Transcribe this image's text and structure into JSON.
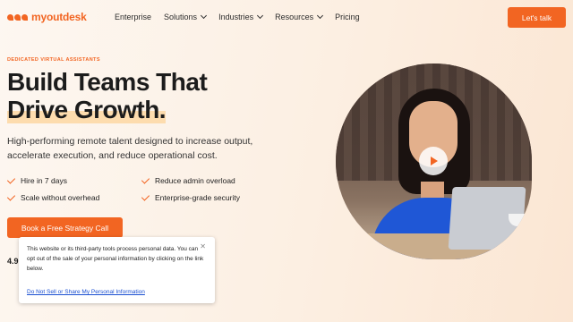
{
  "brand": {
    "name": "myoutdesk",
    "color": "#f26522"
  },
  "nav": {
    "items": [
      {
        "label": "Enterprise",
        "dropdown": false
      },
      {
        "label": "Solutions",
        "dropdown": true
      },
      {
        "label": "Industries",
        "dropdown": true
      },
      {
        "label": "Resources",
        "dropdown": true
      },
      {
        "label": "Pricing",
        "dropdown": false
      }
    ],
    "cta_label": "Let's talk"
  },
  "hero": {
    "eyebrow": "DEDICATED VIRTUAL ASSISTANTS",
    "title_line1": "Build Teams That",
    "title_line2": "Drive Growth.",
    "subtitle": "High-performing remote talent designed to increase output, accelerate execution, and reduce operational cost.",
    "features": [
      "Hire in 7 days",
      "Reduce admin overload",
      "Scale without overhead",
      "Enterprise-grade security"
    ],
    "cta_label": "Book a Free Strategy Call",
    "rating": "4.9"
  },
  "consent": {
    "text": "This website or its third-party tools process personal data. You can opt out of the sale of your personal information by clicking on the link below.",
    "link_label": "Do Not Sell or Share My Personal Information",
    "close_icon": "close-icon"
  }
}
